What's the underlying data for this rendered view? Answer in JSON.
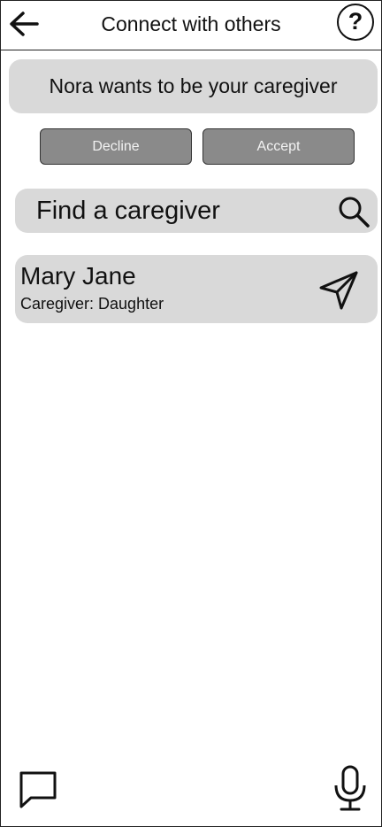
{
  "header": {
    "title": "Connect with others",
    "back_icon": "arrow-left-icon",
    "help_label": "?"
  },
  "request": {
    "message": "Nora wants to be your caregiver",
    "decline_label": "Decline",
    "accept_label": "Accept"
  },
  "search": {
    "placeholder": "Find a caregiver",
    "icon": "search-icon"
  },
  "results": [
    {
      "name": "Mary Jane",
      "role": "Caregiver: Daughter",
      "action_icon": "send-icon"
    }
  ],
  "footer": {
    "left_icon": "chat-icon",
    "right_icon": "microphone-icon"
  },
  "colors": {
    "panel": "#d9d9d9",
    "button": "#8a8a8a",
    "border": "#222222"
  }
}
